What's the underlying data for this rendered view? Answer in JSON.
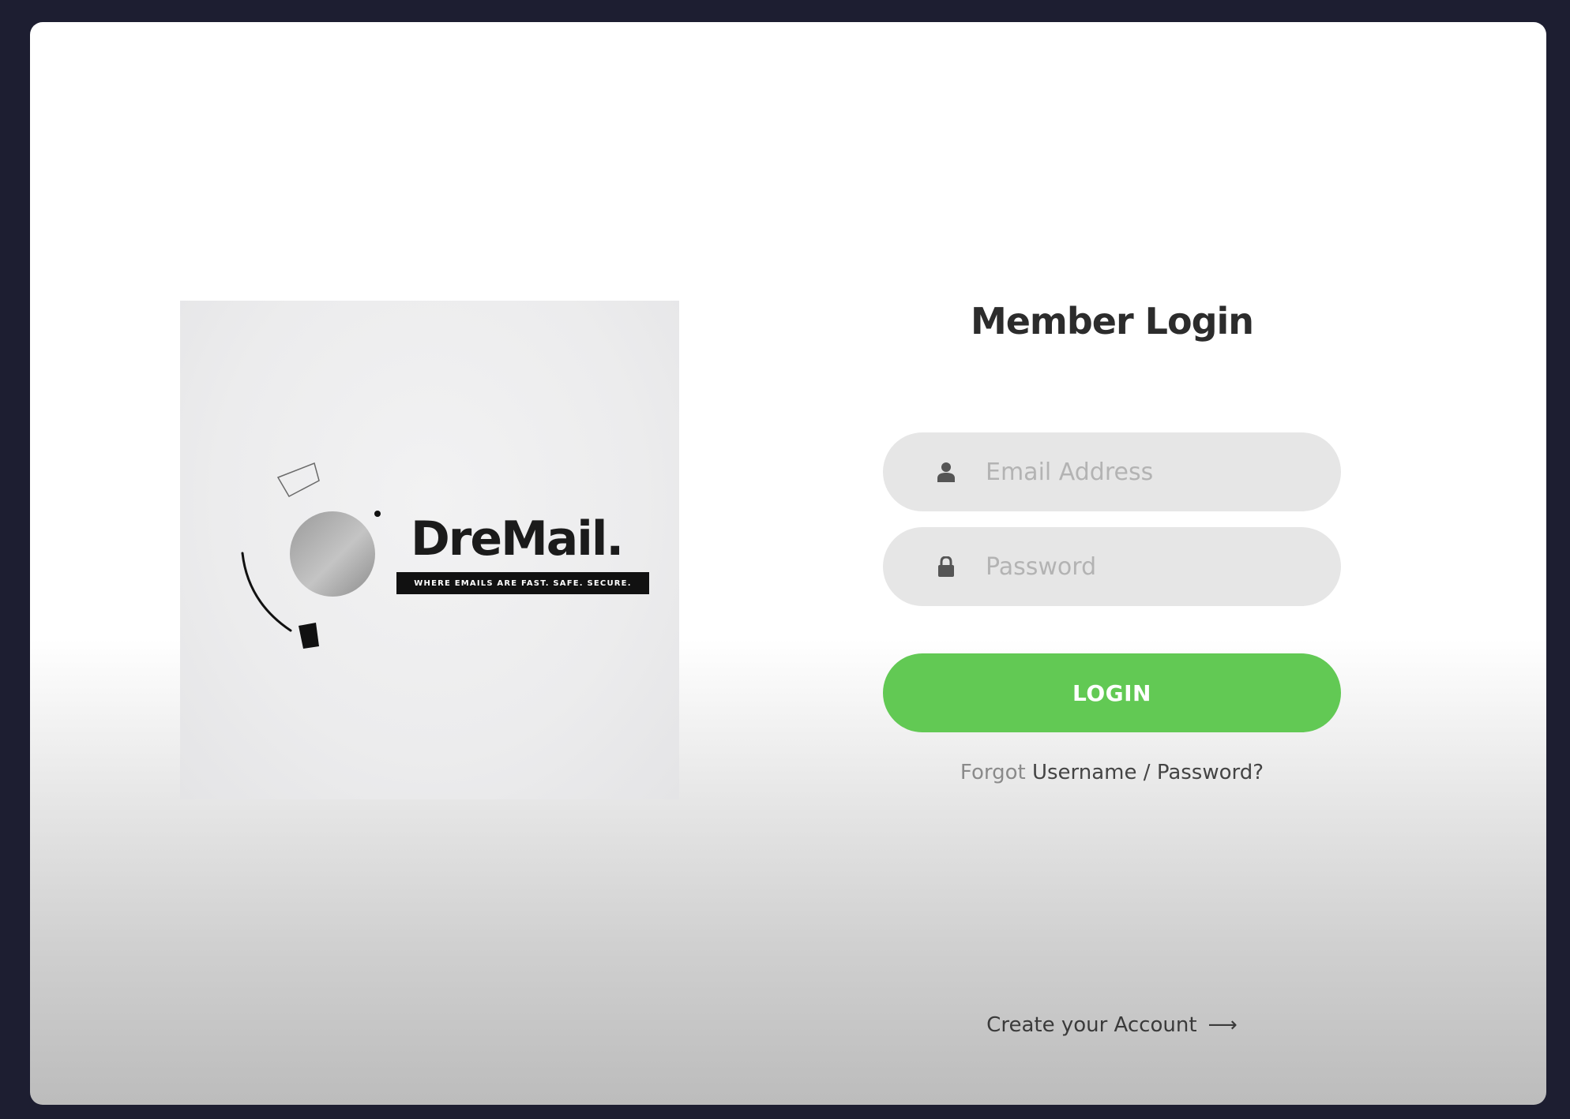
{
  "brand": {
    "name": "DreMail.",
    "tagline": "WHERE EMAILS ARE FAST. SAFE. SECURE."
  },
  "login": {
    "title": "Member Login",
    "email": {
      "placeholder": "Email Address",
      "value": "",
      "icon": "user-icon"
    },
    "password": {
      "placeholder": "Password",
      "value": "",
      "icon": "lock-icon"
    },
    "submit_label": "LOGIN",
    "forgot": {
      "prefix": "Forgot",
      "username": "Username",
      "separator": "/",
      "password": "Password?"
    },
    "create_account": {
      "label": "Create your Account",
      "arrow": "⟶"
    }
  },
  "colors": {
    "page_background": "#1d1e31",
    "accent_green": "#62c954",
    "field_background": "#e6e6e6"
  }
}
